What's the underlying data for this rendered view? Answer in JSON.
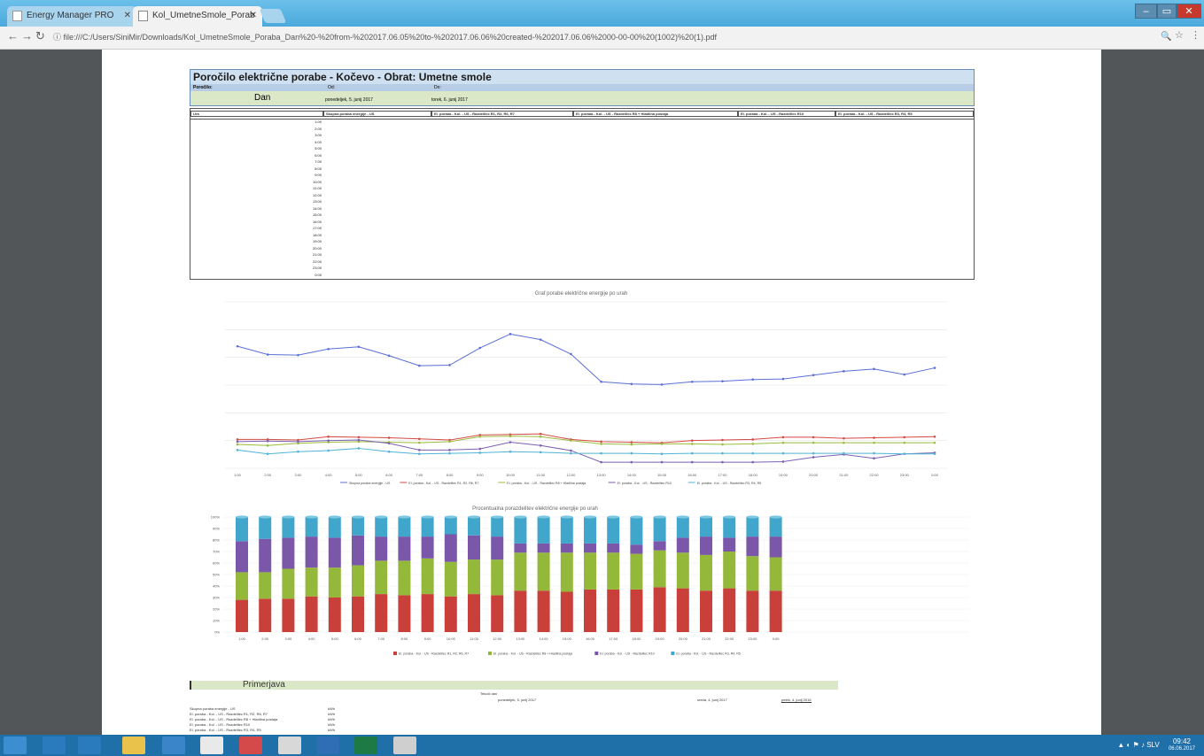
{
  "browser": {
    "tabs": [
      {
        "label": "Energy Manager PRO"
      },
      {
        "label": "Kol_UmetneSmole_Porab"
      }
    ],
    "url": "file:///C:/Users/SiniMir/Downloads/Kol_UmetneSmole_Poraba_Dan%20-%20from-%202017.06.05%20to-%202017.06.06%20created-%202017.06.06%2000-00-00%20(1002)%20(1).pdf",
    "controls": {
      "minimize": "–",
      "maximize": "▭",
      "close": "✕"
    }
  },
  "report": {
    "title": "Poročilo električne porabe - Kočevo - Obrat: Umetne smole",
    "row_labels": [
      "Poročilo:",
      "Od:",
      "Do:"
    ],
    "period_label": "Dan",
    "from_date": "ponedeljek, 5. junij 2017",
    "to_date": "torek, 6. junij 2017",
    "columns": [
      "Ura",
      "Skupna poraba energije - US",
      "El. poraba - Kol. - US - Razdelilec R1, R2, R6, R7",
      "El. poraba - Kol. - US - Razdelilec R8 + Hladilna postaja",
      "El. poraba - Kol. - US - Razdelilec R10",
      "El. poraba - Kol. - US - Razdelilec R3, R4, R5"
    ],
    "hours": [
      "1:00",
      "2:00",
      "3:00",
      "4:00",
      "5:00",
      "6:00",
      "7:00",
      "8:00",
      "9:00",
      "10:00",
      "11:00",
      "12:00",
      "13:00",
      "14:00",
      "15:00",
      "16:00",
      "17:00",
      "18:00",
      "19:00",
      "20:00",
      "21:00",
      "22:00",
      "23:00",
      "0:00"
    ]
  },
  "chart_data": [
    {
      "type": "line",
      "title": "Graf porabe električne energije po urah",
      "x": [
        "1:00",
        "2:00",
        "3:00",
        "4:00",
        "5:00",
        "6:00",
        "7:00",
        "8:00",
        "9:00",
        "10:00",
        "11:00",
        "12:00",
        "13:00",
        "14:00",
        "15:00",
        "16:00",
        "17:00",
        "18:00",
        "19:00",
        "20:00",
        "21:00",
        "22:00",
        "23:00",
        "0:00"
      ],
      "ylim": [
        0,
        3000
      ],
      "grid": true,
      "legend": "bottom",
      "series": [
        {
          "name": "Skupna poraba energije - US",
          "color": "#5b6fd6",
          "values": [
            2200,
            2050,
            2040,
            2150,
            2190,
            2030,
            1850,
            1860,
            2170,
            2420,
            2320,
            2060,
            1560,
            1520,
            1510,
            1560,
            1570,
            1600,
            1610,
            1680,
            1750,
            1790,
            1690,
            1810
          ]
        },
        {
          "name": "El. poraba - Kol. - US - Razdelilec R1, R2, R6, R7",
          "color": "#d24a43",
          "values": [
            520,
            520,
            510,
            570,
            560,
            550,
            530,
            510,
            600,
            610,
            620,
            520,
            480,
            470,
            460,
            500,
            510,
            520,
            560,
            560,
            540,
            550,
            560,
            570
          ]
        },
        {
          "name": "El. poraba - Kol. - US - Razdelilec R8 + Hladilna postaja",
          "color": "#9bbb3a",
          "values": [
            430,
            410,
            450,
            470,
            480,
            470,
            460,
            480,
            570,
            580,
            570,
            500,
            440,
            430,
            440,
            440,
            430,
            440,
            460,
            460,
            460,
            460,
            460,
            460
          ]
        },
        {
          "name": "El. poraba - Kol. - US - Razdelilec R10",
          "color": "#7c5fb2",
          "values": [
            480,
            490,
            480,
            500,
            510,
            450,
            330,
            330,
            350,
            470,
            410,
            320,
            110,
            110,
            110,
            110,
            110,
            110,
            120,
            200,
            250,
            180,
            260,
            280
          ]
        },
        {
          "name": "El. poraba - Kol. - US - Razdelilec R3, R4, R5",
          "color": "#4fb4d8",
          "values": [
            330,
            260,
            300,
            320,
            360,
            300,
            260,
            270,
            280,
            300,
            290,
            270,
            270,
            270,
            260,
            270,
            270,
            270,
            270,
            270,
            270,
            270,
            260,
            260
          ]
        }
      ]
    },
    {
      "type": "bar",
      "stacked": "100%",
      "title": "Procentualna porazdelitev električne energije po urah",
      "categories": [
        "1:00",
        "2:00",
        "3:00",
        "4:00",
        "5:00",
        "6:00",
        "7:00",
        "8:00",
        "9:00",
        "10:00",
        "11:00",
        "12:00",
        "13:00",
        "14:00",
        "15:00",
        "16:00",
        "17:00",
        "18:00",
        "19:00",
        "20:00",
        "21:00",
        "22:00",
        "23:00",
        "0:00"
      ],
      "y_ticks": [
        "0%",
        "10%",
        "20%",
        "30%",
        "40%",
        "50%",
        "60%",
        "70%",
        "80%",
        "90%",
        "100%"
      ],
      "legend": "bottom",
      "series": [
        {
          "name": "El. poraba - Kol. - US - Razdelilec R1, R2, R6, R7",
          "color": "#c9403a",
          "values": [
            28,
            29,
            29,
            31,
            30,
            31,
            33,
            32,
            33,
            31,
            33,
            32,
            36,
            36,
            35,
            37,
            37,
            37,
            39,
            38,
            36,
            38,
            36,
            36
          ]
        },
        {
          "name": "El. poraba - Kol. - US - Razdelilec R8 + Hladilna postaja",
          "color": "#93b83a",
          "values": [
            24,
            23,
            26,
            25,
            26,
            27,
            29,
            30,
            31,
            30,
            30,
            31,
            33,
            33,
            34,
            32,
            32,
            31,
            32,
            31,
            31,
            32,
            30,
            29
          ]
        },
        {
          "name": "El. poraba - Kol. - US - Razdelilec R10",
          "color": "#7a57a8",
          "values": [
            27,
            29,
            27,
            27,
            26,
            26,
            21,
            21,
            19,
            24,
            21,
            20,
            8,
            8,
            8,
            8,
            8,
            8,
            8,
            13,
            16,
            12,
            17,
            18
          ]
        },
        {
          "name": "El. poraba - Kol. - US - Razdelilec R3, R4, R5",
          "color": "#41a6cc",
          "values": [
            21,
            19,
            18,
            17,
            18,
            16,
            17,
            17,
            17,
            15,
            16,
            17,
            23,
            23,
            23,
            23,
            23,
            24,
            21,
            18,
            17,
            18,
            17,
            17
          ]
        }
      ]
    }
  ],
  "comparison": {
    "title": "Primerjava",
    "subheader": "Tekoči dan",
    "columns": [
      "ponedeljek, 5. junij 2017",
      "sreda, 4. junij 2017",
      "petek, 4. junij 2016"
    ],
    "rows": [
      {
        "label": "Skupna poraba energije - US",
        "unit": "kWh"
      },
      {
        "label": "El. poraba - Kol. - US - Razdelilec R1, R2, R6, R7",
        "unit": "kWh"
      },
      {
        "label": "El. poraba - Kol. - US - Razdelilec R8 + Hladilna postaja",
        "unit": "kWh"
      },
      {
        "label": "El. poraba - Kol. - US - Razdelilec R10",
        "unit": "kWh"
      },
      {
        "label": "El. poraba - Kol. - US - Razdelilec R3, R4, R5",
        "unit": "kWh"
      }
    ]
  },
  "taskbar": {
    "time": "09:42",
    "date": "06.06.2017",
    "lang": "SLV"
  },
  "colors": {
    "titlebar": "#4aa9dc",
    "taskbar": "#1f6fa8",
    "pdf_bg": "#525659"
  }
}
